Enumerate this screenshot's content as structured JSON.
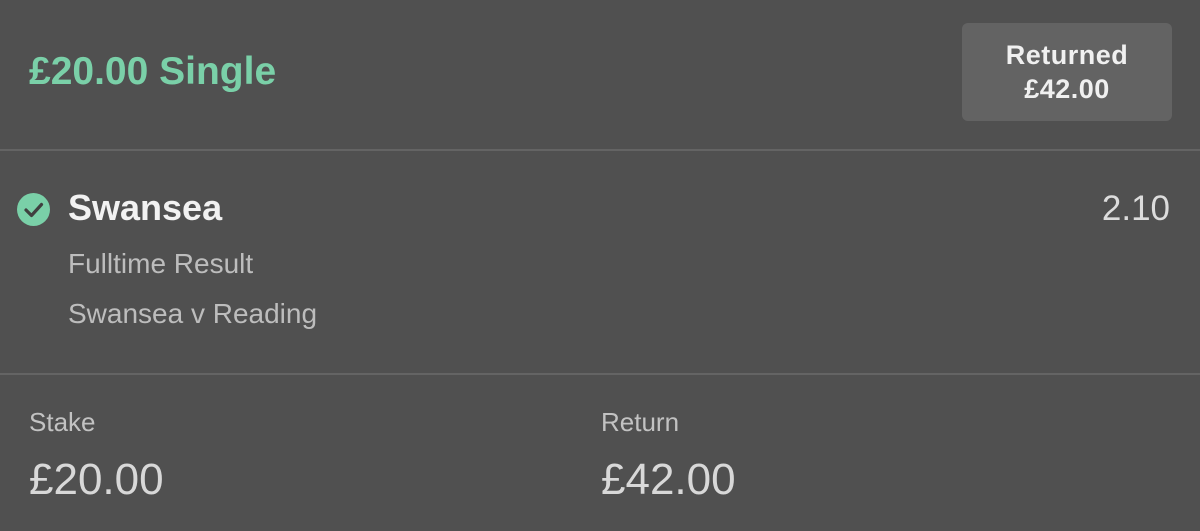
{
  "header": {
    "title": "£20.00 Single",
    "returned_label": "Returned",
    "returned_amount": "£42.00"
  },
  "selection": {
    "status_icon": "check-circle-icon",
    "name": "Swansea",
    "odds": "2.10",
    "market": "Fulltime Result",
    "event": "Swansea v Reading"
  },
  "summary": {
    "stake_label": "Stake",
    "stake_value": "£20.00",
    "return_label": "Return",
    "return_value": "£42.00"
  },
  "colors": {
    "accent": "#7ad0a8",
    "background": "#505050",
    "badge": "#636363",
    "divider": "#646464"
  }
}
